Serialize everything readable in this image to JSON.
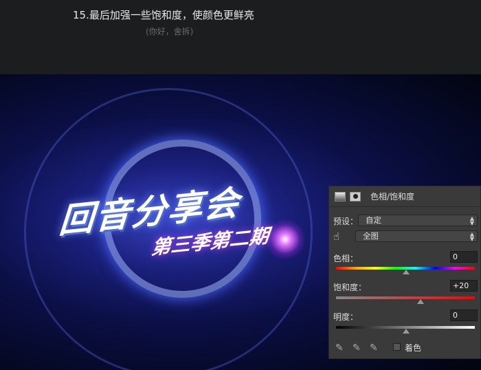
{
  "header": {
    "title": "15.最后加强一些饱和度，使颜色更鲜亮",
    "subtitle": "(你好，舍拆)"
  },
  "artwork": {
    "logo_main": "回音分享会",
    "logo_sub": "第三季第二期"
  },
  "panel": {
    "title": "色相/饱和度",
    "preset_label": "预设：",
    "preset_value": "自定",
    "channel_value": "全图",
    "hue_label": "色相：",
    "hue_value": "0",
    "hue_fraction": 0.5,
    "saturation_label": "饱和度：",
    "saturation_value": "+20",
    "saturation_fraction": 0.6,
    "lightness_label": "明度：",
    "lightness_value": "0",
    "lightness_fraction": 0.5,
    "colorize_label": "着色",
    "colorize_checked": false
  }
}
